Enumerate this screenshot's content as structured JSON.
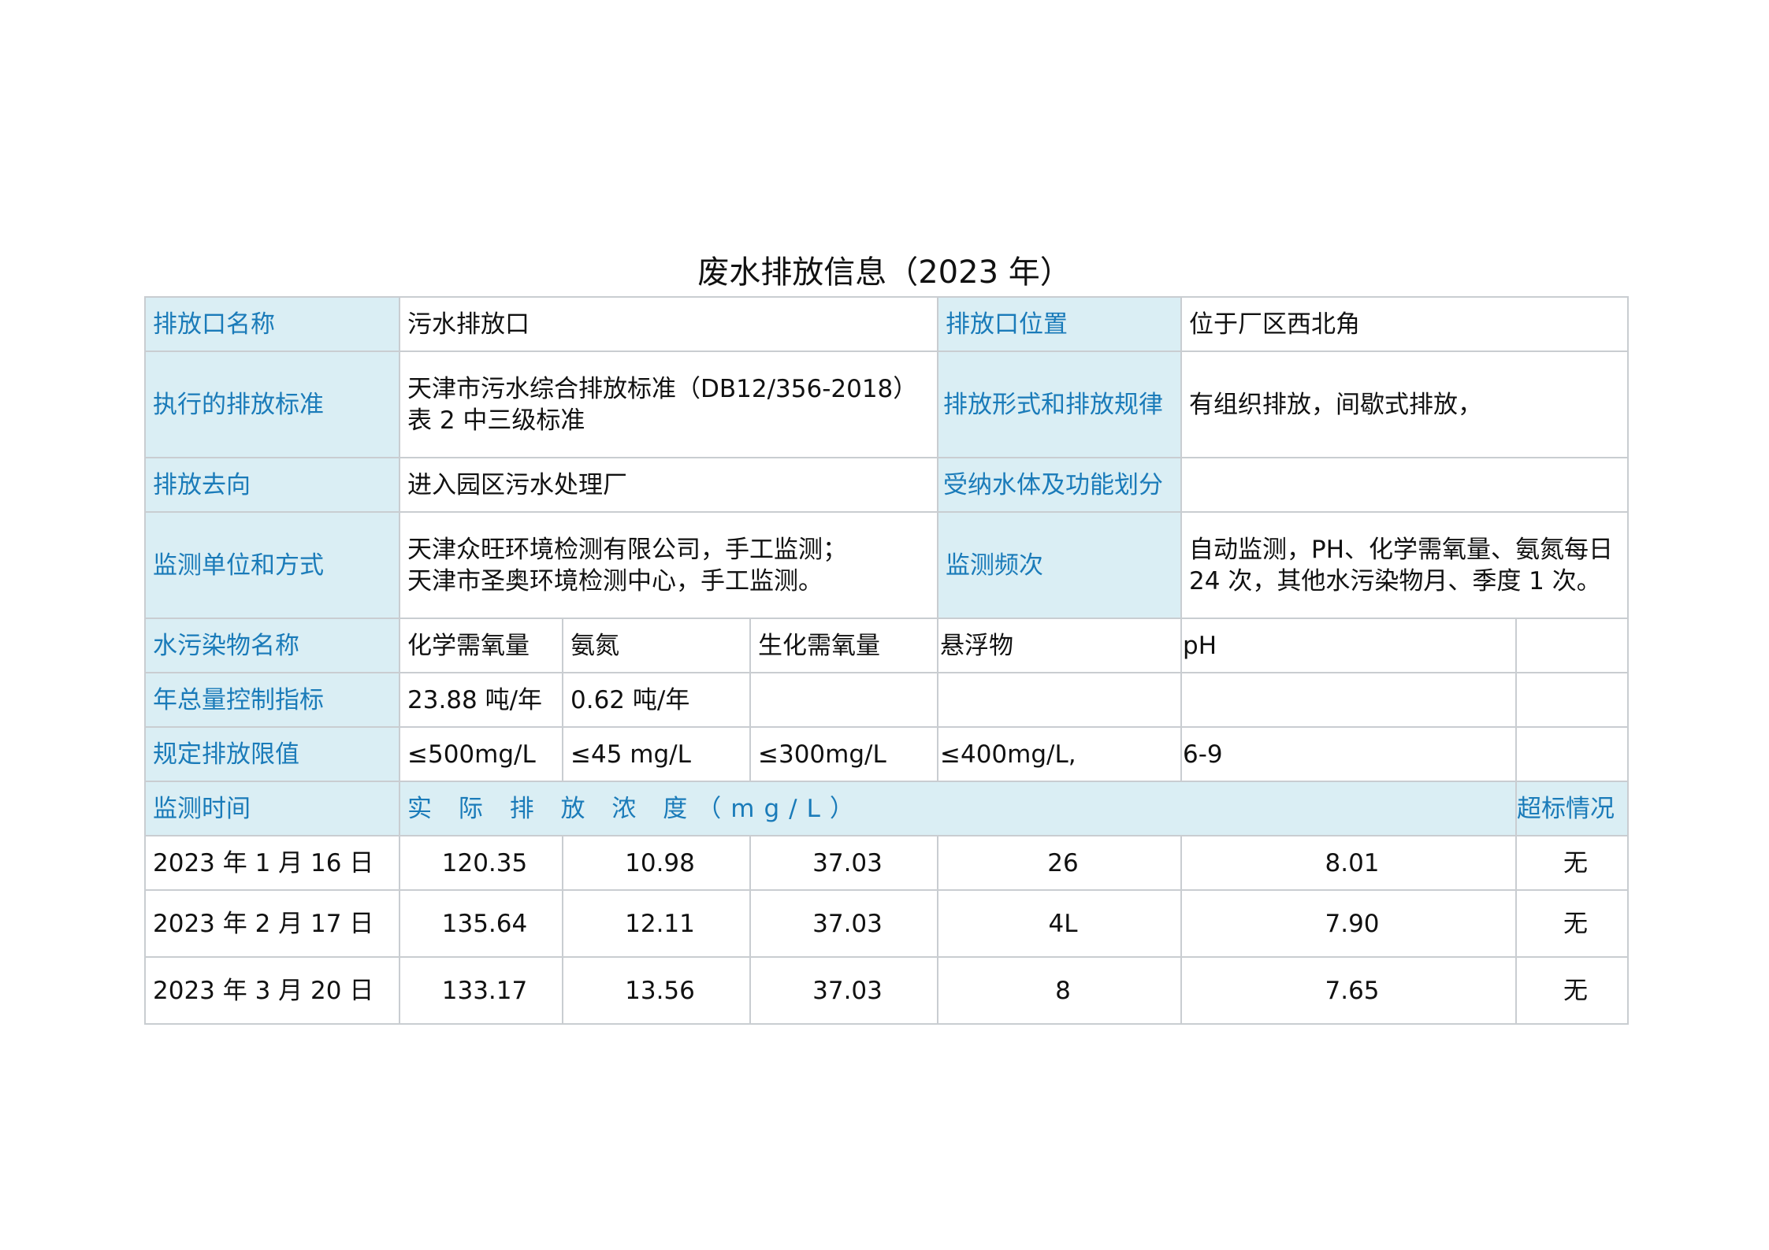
{
  "title": "废水排放信息（2023 年）",
  "outlet": {
    "name_label": "排放口名称",
    "name_value": "污水排放口",
    "location_label": "排放口位置",
    "location_value": "位于厂区西北角",
    "standard_label": "执行的排放标准",
    "standard_line1": "天津市污水综合排放标准（DB12/356-2018）",
    "standard_line2": "表 2  中三级标准",
    "pattern_label": "排放形式和排放规律",
    "pattern_value": "有组织排放，间歇式排放，",
    "destination_label": "排放去向",
    "destination_value": "进入园区污水处理厂",
    "receiving_label": "受纳水体及功能划分",
    "receiving_value": "",
    "monitor_unit_label": "监测单位和方式",
    "monitor_unit_line1": "天津众旺环境检测有限公司，手工监测；",
    "monitor_unit_line2": "天津市圣奥环境检测中心，手工监测。",
    "frequency_label": "监测频次",
    "frequency_line1": "自动监测，PH、化学需氧量、氨氮每日",
    "frequency_line2": "24 次，其他水污染物月、季度 1 次。"
  },
  "pollutants": {
    "names_label": "水污染物名称",
    "names": [
      "化学需氧量",
      "氨氮",
      "生化需氧量",
      "悬浮物",
      "pH"
    ],
    "annual_label": "年总量控制指标",
    "annual": [
      "23.88 吨/年",
      "0.62  吨/年",
      "",
      "",
      ""
    ],
    "limits_label": "规定排放限值",
    "limits": [
      "≤500mg/L",
      "≤45 mg/L",
      "≤300mg/L",
      "≤400mg/L,",
      "6-9"
    ]
  },
  "monitoring": {
    "time_label": "监测时间",
    "concentration_label": "实 际 排 放 浓 度（mg/L）",
    "exceed_label": "超标情况",
    "rows": [
      {
        "date": "2023 年 1 月 16 日",
        "values": [
          "120.35",
          "10.98",
          "37.03",
          "26",
          "8.01"
        ],
        "exceed": "无"
      },
      {
        "date": "2023 年 2 月 17 日",
        "values": [
          "135.64",
          "12.11",
          "37.03",
          "4L",
          "7.90"
        ],
        "exceed": "无"
      },
      {
        "date": "2023 年 3 月 20 日",
        "values": [
          "133.17",
          "13.56",
          "37.03",
          "8",
          "7.65"
        ],
        "exceed": "无"
      }
    ]
  }
}
